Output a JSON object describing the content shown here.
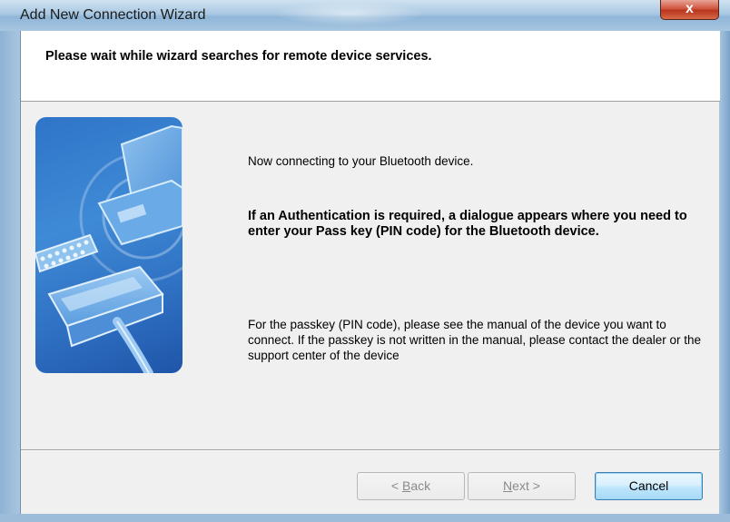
{
  "window": {
    "title": "Add New Connection Wizard",
    "close_glyph": "x"
  },
  "header": {
    "text": "Please wait while wizard searches for remote device services."
  },
  "content": {
    "connecting": "Now connecting to your Bluetooth device.",
    "auth_notice": "If an Authentication is required, a dialogue appears where you need to enter your Pass key (PIN code) for the Bluetooth device.",
    "passkey_help": "For the passkey (PIN code), please see the manual of the device you want to connect. If the passkey is not written in the manual, please contact the dealer or the support center of the device"
  },
  "buttons": {
    "back": {
      "prefix": "< ",
      "accel": "B",
      "rest": "ack",
      "enabled": false
    },
    "next": {
      "accel": "N",
      "rest": "ext",
      "suffix": " >",
      "enabled": false
    },
    "cancel": {
      "label": "Cancel",
      "enabled": true
    }
  },
  "colors": {
    "accent": "#3c7fb1",
    "image_blue": "#2f74c8",
    "close_red": "#c9452b"
  },
  "icons": {
    "side_image": "bluetooth-devices-illustration",
    "close": "close-icon"
  }
}
